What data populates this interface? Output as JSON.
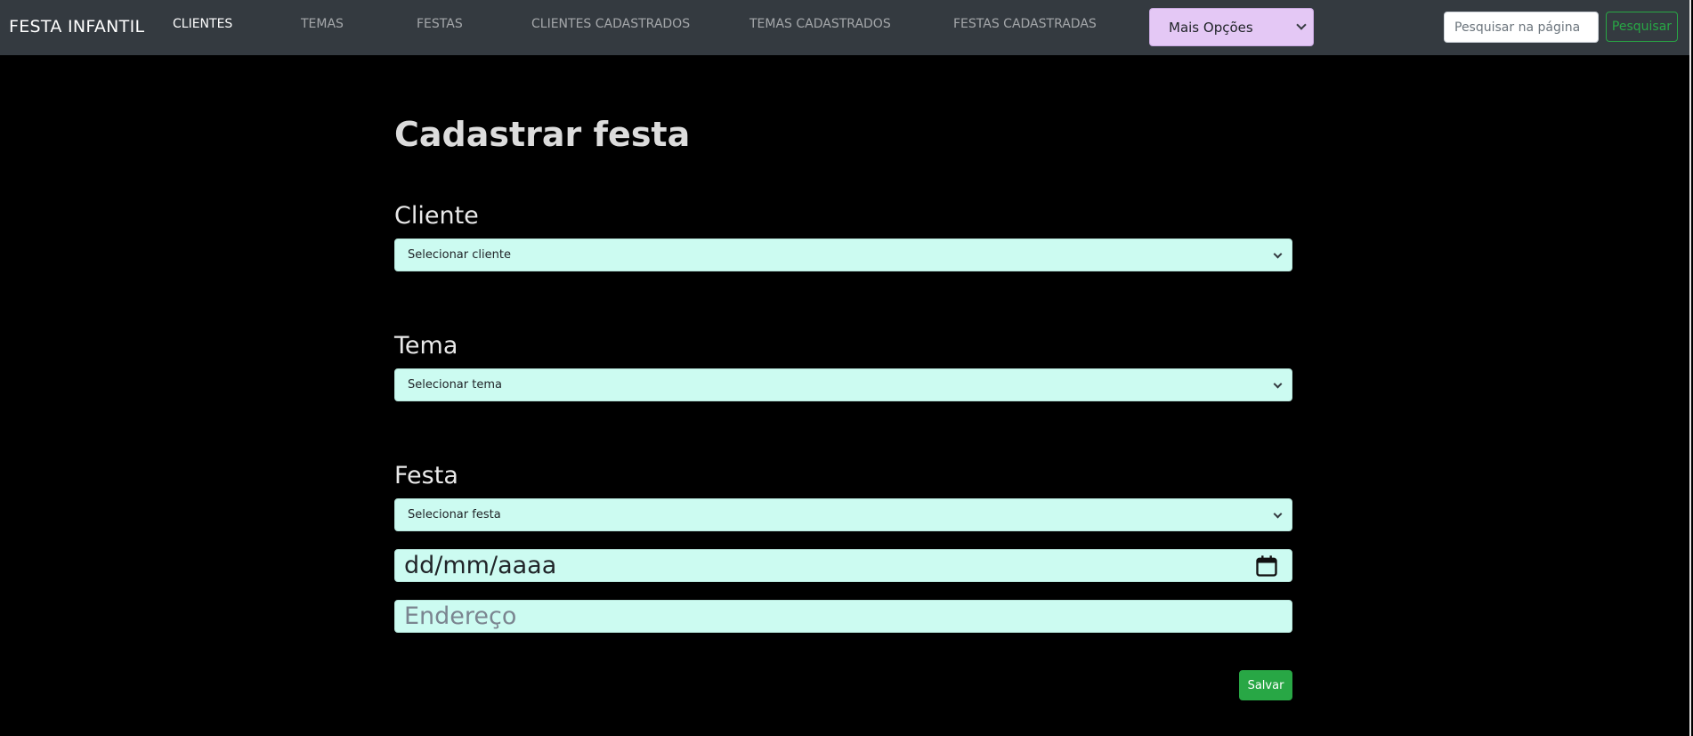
{
  "navbar": {
    "brand": "FESTA INFANTIL",
    "links": [
      {
        "label": "CLIENTES",
        "active": true
      },
      {
        "label": "TEMAS",
        "active": false
      },
      {
        "label": "FESTAS",
        "active": false
      },
      {
        "label": "CLIENTES CADASTRADOS",
        "active": false
      },
      {
        "label": "TEMAS CADASTRADOS",
        "active": false
      },
      {
        "label": "FESTAS CADASTRADAS",
        "active": false
      }
    ],
    "more_options": {
      "selected": "Mais Opções"
    },
    "search": {
      "placeholder": "Pesquisar na página",
      "value": "",
      "button_label": "Pesquisar"
    }
  },
  "form": {
    "title": "Cadastrar festa",
    "cliente": {
      "label": "Cliente",
      "selected": "Selecionar cliente"
    },
    "tema": {
      "label": "Tema",
      "selected": "Selecionar tema"
    },
    "festa": {
      "label": "Festa",
      "selected": "Selecionar festa"
    },
    "date": {
      "placeholder": "dd/mm/aaaa",
      "value": ""
    },
    "endereco": {
      "placeholder": "Endereço",
      "value": ""
    },
    "save_label": "Salvar"
  },
  "colors": {
    "page_background": "#000000",
    "navbar_background": "#343a40",
    "field_background": "#ccfbf1",
    "more_options_background": "#e4c8f5",
    "success": "#28a745"
  },
  "icons": {
    "calendar": "calendar-icon",
    "dropdown": "chevron-down-icon"
  }
}
